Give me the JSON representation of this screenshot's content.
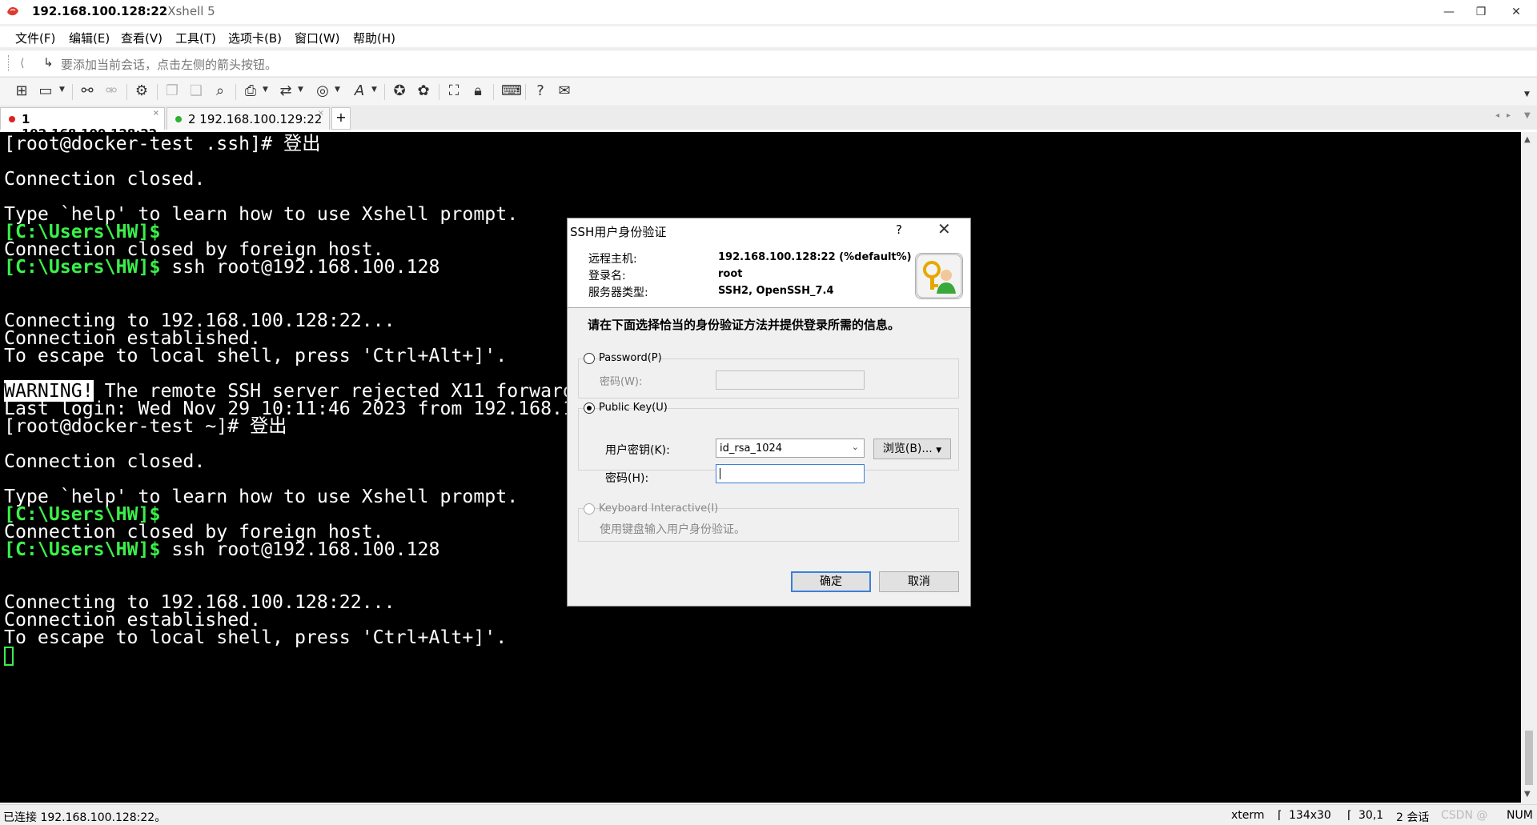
{
  "window": {
    "title_host": "192.168.100.128:22",
    "title_app": "Xshell 5",
    "min_glyph": "—",
    "max_glyph": "❐",
    "close_glyph": "✕"
  },
  "menu": [
    "文件(F)",
    "编辑(E)",
    "查看(V)",
    "工具(T)",
    "选项卡(B)",
    "窗口(W)",
    "帮助(H)"
  ],
  "session_hint": {
    "text": "要添加当前会话，点击左侧的箭头按钮。"
  },
  "toolbar": {
    "icons": [
      "new-session-icon",
      "open-folder-icon",
      "reconnect-icon",
      "disconnect-icon",
      "properties-icon",
      "copy-icon",
      "paste-icon",
      "find-icon",
      "print-icon",
      "transfer-icon",
      "globe-icon",
      "font-icon",
      "xftp-icon",
      "xagent-icon",
      "fullscreen-icon",
      "lock-icon",
      "keyboard-icon",
      "help-icon",
      "chat-icon"
    ]
  },
  "tabs": [
    {
      "label": "1 192.168.100.128:22",
      "status_color": "#e02020",
      "active": true
    },
    {
      "label": "2 192.168.100.129:22",
      "status_color": "#2fb02f",
      "active": false
    }
  ],
  "terminal": {
    "lines": [
      {
        "parts": [
          {
            "t": "[root@docker-test .ssh]# 登出"
          }
        ]
      },
      {
        "parts": [
          {
            "t": ""
          }
        ]
      },
      {
        "parts": [
          {
            "t": "Connection closed."
          }
        ]
      },
      {
        "parts": [
          {
            "t": ""
          }
        ]
      },
      {
        "parts": [
          {
            "t": "Type `help' to learn how to use Xshell prompt."
          }
        ]
      },
      {
        "parts": [
          {
            "t": "[C:\\Users\\HW]$",
            "c": "green"
          }
        ]
      },
      {
        "parts": [
          {
            "t": "Connection closed by foreign host."
          }
        ]
      },
      {
        "parts": [
          {
            "t": "[C:\\Users\\HW]$",
            "c": "green"
          },
          {
            "t": " ssh root@192.168.100.128"
          }
        ]
      },
      {
        "parts": [
          {
            "t": ""
          }
        ]
      },
      {
        "parts": [
          {
            "t": ""
          }
        ]
      },
      {
        "parts": [
          {
            "t": "Connecting to 192.168.100.128:22..."
          }
        ]
      },
      {
        "parts": [
          {
            "t": "Connection established."
          }
        ]
      },
      {
        "parts": [
          {
            "t": "To escape to local shell, press 'Ctrl+Alt+]'."
          }
        ]
      },
      {
        "parts": [
          {
            "t": ""
          }
        ]
      },
      {
        "parts": [
          {
            "t": "WARNING!",
            "c": "warn"
          },
          {
            "t": " The remote SSH server rejected X11 forwarding request."
          }
        ]
      },
      {
        "parts": [
          {
            "t": "Last login: Wed Nov 29 10:11:46 2023 from 192.168.100.1"
          }
        ]
      },
      {
        "parts": [
          {
            "t": "[root@docker-test ~]# 登出"
          }
        ]
      },
      {
        "parts": [
          {
            "t": ""
          }
        ]
      },
      {
        "parts": [
          {
            "t": "Connection closed."
          }
        ]
      },
      {
        "parts": [
          {
            "t": ""
          }
        ]
      },
      {
        "parts": [
          {
            "t": "Type `help' to learn how to use Xshell prompt."
          }
        ]
      },
      {
        "parts": [
          {
            "t": "[C:\\Users\\HW]$",
            "c": "green"
          }
        ]
      },
      {
        "parts": [
          {
            "t": "Connection closed by foreign host."
          }
        ]
      },
      {
        "parts": [
          {
            "t": "[C:\\Users\\HW]$",
            "c": "green"
          },
          {
            "t": " ssh root@192.168.100.128"
          }
        ]
      },
      {
        "parts": [
          {
            "t": ""
          }
        ]
      },
      {
        "parts": [
          {
            "t": ""
          }
        ]
      },
      {
        "parts": [
          {
            "t": "Connecting to 192.168.100.128:22..."
          }
        ]
      },
      {
        "parts": [
          {
            "t": "Connection established."
          }
        ]
      },
      {
        "parts": [
          {
            "t": "To escape to local shell, press 'Ctrl+Alt+]'."
          }
        ]
      },
      {
        "parts": [
          {
            "t": "",
            "c": "cursor"
          }
        ]
      }
    ]
  },
  "dialog": {
    "title": "SSH用户身份验证",
    "help": "?",
    "close": "✕",
    "remote_host_label": "远程主机:",
    "remote_host_value": "192.168.100.128:22 (%default%)",
    "login_label": "登录名:",
    "login_value": "root",
    "server_type_label": "服务器类型:",
    "server_type_value": "SSH2, OpenSSH_7.4",
    "instruction": "请在下面选择恰当的身份验证方法并提供登录所需的信息。",
    "password_option": "Password(P)",
    "password_field_label": "密码(W):",
    "pubkey_option": "Public Key(U)",
    "user_key_label": "用户密钥(K):",
    "user_key_value": "id_rsa_1024",
    "browse_button": "浏览(B)...",
    "passphrase_label": "密码(H):",
    "keyboard_option": "Keyboard Interactive(I)",
    "keyboard_desc": "使用键盘输入用户身份验证。",
    "ok_button": "确定",
    "cancel_button": "取消"
  },
  "status": {
    "connection": "已连接 192.168.100.128:22。",
    "terminal_type": "xterm",
    "size": "134x30",
    "cursor_pos": "30,1",
    "sessions": "2 会话",
    "watermark": "CSDN @",
    "num": "NUM"
  }
}
